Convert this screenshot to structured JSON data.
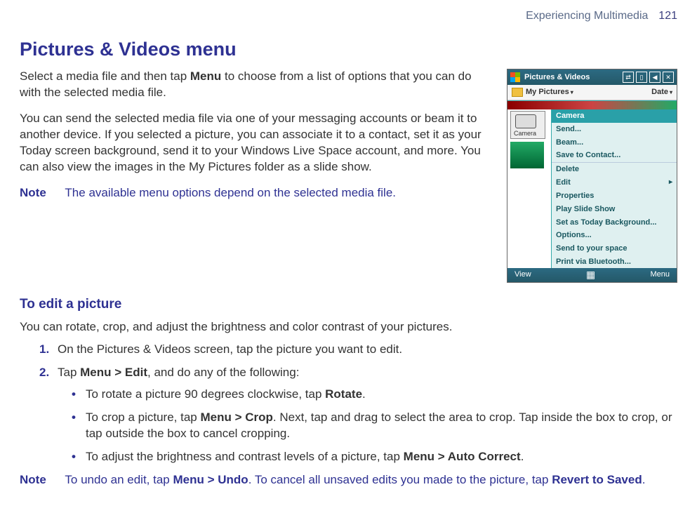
{
  "header": {
    "chapter": "Experiencing Multimedia",
    "pagenum": "121"
  },
  "h1": "Pictures & Videos menu",
  "para1_a": "Select a media file and then tap ",
  "para1_bold": "Menu",
  "para1_b": " to choose from a list of options that you can do with the selected media file.",
  "para2": "You can send the selected media file via one of your messaging accounts or beam it to another device. If you selected a picture, you can associate it to a contact, set it as your Today screen background, send it to your Windows Live Space account, and more. You can also view the images in the My Pictures folder as a slide show.",
  "note": {
    "label": "Note",
    "text": "The available menu options depend on the selected media file."
  },
  "device": {
    "title": "Pictures & Videos",
    "sub_left": "My Pictures",
    "sub_right": "Date",
    "camera_label": "Camera",
    "menu_items": [
      "Camera",
      "Send...",
      "Beam...",
      "Save to Contact...",
      "Delete",
      "Edit",
      "Properties",
      "Play Slide Show",
      "Set as Today Background...",
      "Options...",
      "Send to your space",
      "Print via Bluetooth..."
    ],
    "soft_left": "View",
    "soft_right": "Menu"
  },
  "h2": "To edit a picture",
  "para3": "You can rotate, crop, and adjust the brightness and color contrast of your pictures.",
  "step1": "On the Pictures & Videos screen, tap the picture you want to edit.",
  "step2_a": "Tap ",
  "step2_bold": "Menu > Edit",
  "step2_b": ", and do any of the following:",
  "bullet1_a": "To rotate a picture 90 degrees clockwise, tap ",
  "bullet1_bold": "Rotate",
  "bullet1_b": ".",
  "bullet2_a": "To crop a picture, tap ",
  "bullet2_bold": "Menu > Crop",
  "bullet2_b": ". Next, tap and drag to select the area to crop. Tap inside the box to crop, or tap outside the box to cancel cropping.",
  "bullet3_a": "To adjust the brightness and contrast levels of a picture, tap ",
  "bullet3_bold": "Menu > Auto Correct",
  "bullet3_b": ".",
  "footnote": {
    "label": "Note",
    "a": "To undo an edit, tap ",
    "bold1": "Menu > Undo",
    "b": ". To cancel all unsaved edits you made to the picture, tap ",
    "bold2": "Revert to Saved",
    "c": "."
  }
}
